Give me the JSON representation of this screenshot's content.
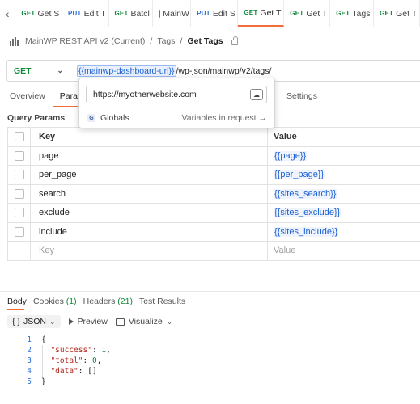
{
  "tabs": [
    {
      "method": "GET",
      "title": "Get S",
      "dot": true,
      "active": false
    },
    {
      "method": "PUT",
      "title": "Edit T",
      "dot": true,
      "active": false
    },
    {
      "method": "GET",
      "title": "Batcl",
      "dot": true,
      "active": false
    },
    {
      "method": "",
      "title": "MainW",
      "dot": false,
      "active": false,
      "doc": true
    },
    {
      "method": "PUT",
      "title": "Edit S",
      "dot": true,
      "active": false
    },
    {
      "method": "GET",
      "title": "Get T",
      "dot": true,
      "active": true
    },
    {
      "method": "GET",
      "title": "Get T",
      "dot": true,
      "active": false
    },
    {
      "method": "GET",
      "title": "Tags",
      "dot": true,
      "active": false
    },
    {
      "method": "GET",
      "title": "Get T",
      "dot": true,
      "active": false
    }
  ],
  "breadcrumb": {
    "collection": "MainWP REST API v2 (Current)",
    "folder": "Tags",
    "request": "Get Tags"
  },
  "request": {
    "method": "GET",
    "url_var": "{{mainwp-dashboard-url}}",
    "url_rest": "/wp-json/mainwp/v2/tags/"
  },
  "request_tabs": {
    "overview": "Overview",
    "params": "Params",
    "settings": "Settings"
  },
  "popup": {
    "value": "https://myotherwebsite.com",
    "scope_letter": "G",
    "scope": "Globals",
    "link": "Variables in request →"
  },
  "query_params": {
    "title": "Query Params",
    "headers": {
      "key": "Key",
      "value": "Value"
    },
    "rows": [
      {
        "key": "page",
        "value": "{{page}}"
      },
      {
        "key": "per_page",
        "value": "{{per_page}}"
      },
      {
        "key": "search",
        "value": "{{sites_search}}"
      },
      {
        "key": "exclude",
        "value": "{{sites_exclude}}"
      },
      {
        "key": "include",
        "value": "{{sites_include}}"
      }
    ],
    "placeholder": {
      "key": "Key",
      "value": "Value"
    }
  },
  "response": {
    "tabs": [
      {
        "label": "Body",
        "count": ""
      },
      {
        "label": "Cookies",
        "count": "(1)"
      },
      {
        "label": "Headers",
        "count": "(21)"
      },
      {
        "label": "Test Results",
        "count": ""
      }
    ],
    "format": "JSON",
    "format_prefix": "{ }",
    "preview": "Preview",
    "visualize": "Visualize",
    "lines": [
      {
        "n": "1",
        "text": "{"
      },
      {
        "n": "2",
        "key": "\"success\"",
        "val": "1",
        "tail": ","
      },
      {
        "n": "3",
        "key": "\"total\"",
        "val": "0",
        "tail": ","
      },
      {
        "n": "4",
        "key": "\"data\"",
        "val": "[]",
        "tail": ""
      },
      {
        "n": "5",
        "text": "}"
      }
    ]
  },
  "colors": {
    "accent": "#f26b3a",
    "get": "#0f8a3a",
    "put": "#2b6fd6",
    "variable": "#1a5fd0"
  }
}
